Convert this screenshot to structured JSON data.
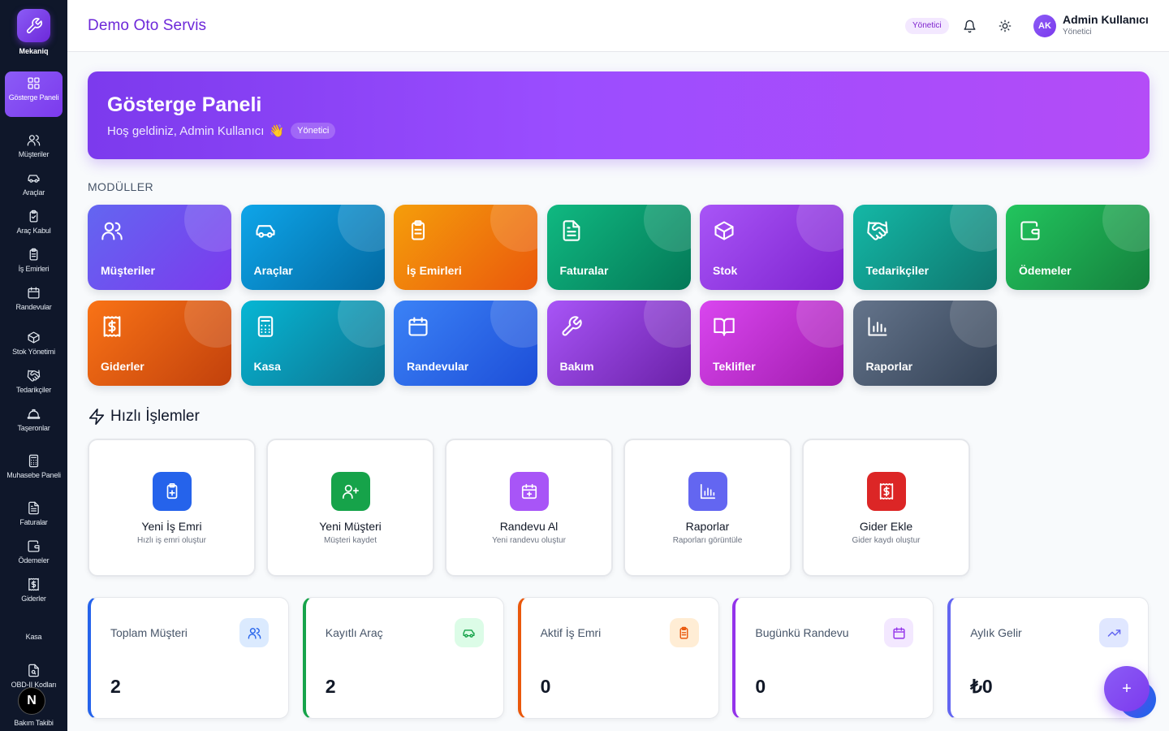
{
  "brand": {
    "name": "Mekaniq",
    "icon": "wrench-icon"
  },
  "sidebar": {
    "items": [
      {
        "label": "Gösterge Paneli",
        "icon": "grid-icon",
        "active": true
      },
      {
        "label": "Müşteriler",
        "icon": "users-icon"
      },
      {
        "label": "Araçlar",
        "icon": "car-icon"
      },
      {
        "label": "Araç Kabul",
        "icon": "clipboard-check-icon"
      },
      {
        "label": "İş Emirleri",
        "icon": "clipboard-list-icon"
      },
      {
        "label": "Randevular",
        "icon": "calendar-icon"
      },
      {
        "label": "Stok Yönetimi",
        "icon": "box-icon"
      },
      {
        "label": "Tedarikçiler",
        "icon": "handshake-icon"
      },
      {
        "label": "Taşeronlar",
        "icon": "hard-hat-icon"
      },
      {
        "label": "Muhasebe Paneli",
        "icon": "calculator-icon"
      },
      {
        "label": "Faturalar",
        "icon": "file-text-icon"
      },
      {
        "label": "Ödemeler",
        "icon": "wallet-icon"
      },
      {
        "label": "Giderler",
        "icon": "receipt-icon"
      },
      {
        "label": "Kasa",
        "icon": "cash-register-icon"
      },
      {
        "label": "OBD-II Kodları",
        "icon": "file-search-icon"
      },
      {
        "label": "Bakım Takibi",
        "icon": "wrench-icon"
      }
    ],
    "overlay_badge": "N"
  },
  "header": {
    "shop_name": "Demo Oto Servis",
    "role_pill": "Yönetici",
    "user": {
      "initials": "AK",
      "name": "Admin Kullanıcı",
      "role": "Yönetici"
    }
  },
  "hero": {
    "title": "Gösterge Paneli",
    "subtitle": "Hoş geldiniz, Admin Kullanıcı",
    "emoji": "👋",
    "badge": "Yönetici"
  },
  "modules": {
    "heading": "MODÜLLER",
    "items": [
      {
        "label": "Müşteriler",
        "icon": "users-icon",
        "colors": [
          "#6366f1",
          "#7c3aed"
        ]
      },
      {
        "label": "Araçlar",
        "icon": "car-icon",
        "colors": [
          "#0ea5e9",
          "#0369a1"
        ]
      },
      {
        "label": "İş Emirleri",
        "icon": "clipboard-list-icon",
        "colors": [
          "#f59e0b",
          "#ea580c"
        ]
      },
      {
        "label": "Faturalar",
        "icon": "file-text-icon",
        "colors": [
          "#10b981",
          "#047857"
        ]
      },
      {
        "label": "Stok",
        "icon": "box-icon",
        "colors": [
          "#a855f7",
          "#7e22ce"
        ]
      },
      {
        "label": "Tedarikçiler",
        "icon": "handshake-icon",
        "colors": [
          "#14b8a6",
          "#0f766e"
        ]
      },
      {
        "label": "Ödemeler",
        "icon": "wallet-icon",
        "colors": [
          "#22c55e",
          "#15803d"
        ]
      },
      {
        "label": "Giderler",
        "icon": "receipt-icon",
        "colors": [
          "#f97316",
          "#c2410c"
        ]
      },
      {
        "label": "Kasa",
        "icon": "calculator-icon",
        "colors": [
          "#06b6d4",
          "#0e7490"
        ]
      },
      {
        "label": "Randevular",
        "icon": "calendar-icon",
        "colors": [
          "#3b82f6",
          "#1d4ed8"
        ]
      },
      {
        "label": "Bakım",
        "icon": "wrench-icon",
        "colors": [
          "#a855f7",
          "#6b21a8"
        ]
      },
      {
        "label": "Teklifler",
        "icon": "book-open-icon",
        "colors": [
          "#d946ef",
          "#a21caf"
        ]
      },
      {
        "label": "Raporlar",
        "icon": "bar-chart-icon",
        "colors": [
          "#64748b",
          "#334155"
        ]
      }
    ]
  },
  "quick_actions": {
    "heading": "Hızlı İşlemler",
    "items": [
      {
        "label": "Yeni İş Emri",
        "sub": "Hızlı iş emri oluştur",
        "icon": "clipboard-plus-icon",
        "color": "#2563eb"
      },
      {
        "label": "Yeni Müşteri",
        "sub": "Müşteri kaydet",
        "icon": "user-plus-icon",
        "color": "#16a34a"
      },
      {
        "label": "Randevu Al",
        "sub": "Yeni randevu oluştur",
        "icon": "calendar-plus-icon",
        "color": "#a855f7"
      },
      {
        "label": "Raporlar",
        "sub": "Raporları görüntüle",
        "icon": "bar-chart-icon",
        "color": "#6366f1"
      },
      {
        "label": "Gider Ekle",
        "sub": "Gider kaydı oluştur",
        "icon": "receipt-icon",
        "color": "#dc2626"
      }
    ]
  },
  "stats": [
    {
      "label": "Toplam Müşteri",
      "value": "2",
      "icon": "users-icon",
      "color": "#2563eb",
      "bg": "#dbeafe"
    },
    {
      "label": "Kayıtlı Araç",
      "value": "2",
      "icon": "car-icon",
      "color": "#16a34a",
      "bg": "#dcfce7"
    },
    {
      "label": "Aktif İş Emri",
      "value": "0",
      "icon": "clipboard-list-icon",
      "color": "#ea580c",
      "bg": "#ffedd5"
    },
    {
      "label": "Bugünkü Randevu",
      "value": "0",
      "icon": "calendar-icon",
      "color": "#9333ea",
      "bg": "#f3e8ff"
    },
    {
      "label": "Aylık Gelir",
      "value": "₺0",
      "icon": "trending-up-icon",
      "color": "#6366f1",
      "bg": "#e0e7ff"
    }
  ],
  "fab": {
    "label": "+",
    "icon": "plus-icon"
  }
}
